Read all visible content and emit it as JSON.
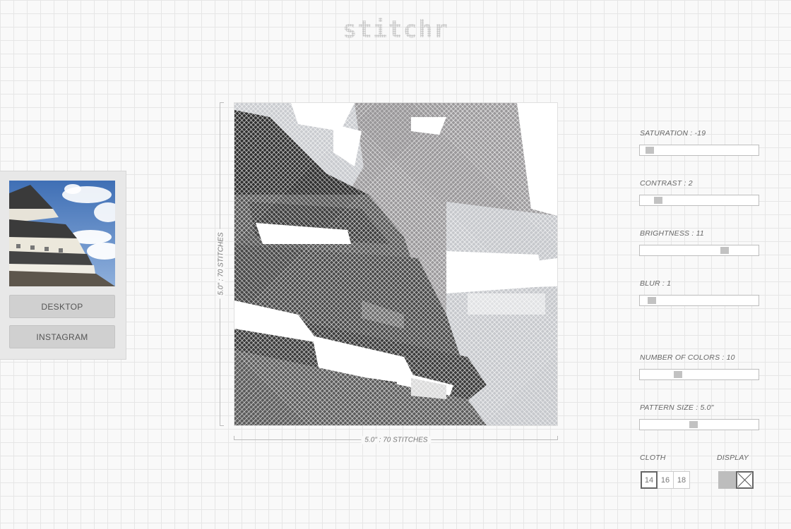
{
  "app": {
    "logo": "stitchr"
  },
  "sidebar": {
    "thumbnail_icon": "photo-thumbnail-castle",
    "buttons": {
      "desktop": "DESKTOP",
      "instagram": "INSTAGRAM"
    }
  },
  "pattern": {
    "height_label": "5.0\" : 70 STITCHES",
    "width_label": "5.0\" : 70 STITCHES",
    "stitches": 70
  },
  "controls": {
    "saturation": {
      "label": "SATURATION : -19",
      "position": 0.04
    },
    "contrast": {
      "label": "CONTRAST : 2",
      "position": 0.12
    },
    "brightness": {
      "label": "BRIGHTNESS : 11",
      "position": 0.74
    },
    "blur": {
      "label": "BLUR : 1",
      "position": 0.06
    },
    "colors": {
      "label": "NUMBER OF COLORS : 10",
      "position": 0.3
    },
    "pattern_size": {
      "label": "PATTERN SIZE : 5.0\"",
      "position": 0.45
    }
  },
  "cloth": {
    "label": "CLOTH",
    "options": [
      "14",
      "16",
      "18"
    ],
    "selected": "14"
  },
  "display": {
    "label": "DISPLAY",
    "modes": [
      "solid-swatch-icon",
      "cross-stitch-icon"
    ],
    "selected": "cross-stitch-icon"
  }
}
